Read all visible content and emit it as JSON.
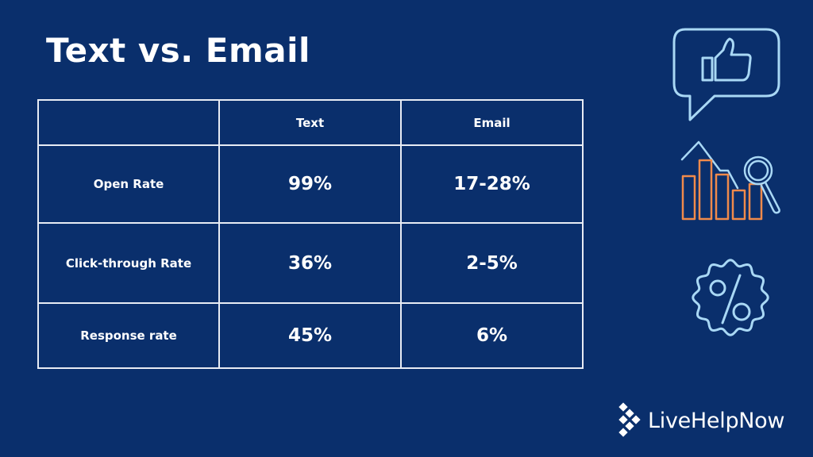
{
  "title": "Text vs. Email",
  "table": {
    "headers": [
      "",
      "Text",
      "Email"
    ],
    "rows": [
      {
        "label": "Open Rate",
        "text": "99%",
        "email": "17-28%"
      },
      {
        "label": "Click-through Rate",
        "text": "36%",
        "email": "2-5%"
      },
      {
        "label": "Response rate",
        "text": "45%",
        "email": "6%"
      }
    ]
  },
  "icons": [
    "thumbs-up-speech-bubble-icon",
    "bar-chart-magnifier-icon",
    "percent-badge-icon"
  ],
  "brand": {
    "name": "LiveHelpNow",
    "colors": {
      "background": "#0a2f6c",
      "icon_light_blue": "#a9d8f5",
      "icon_orange": "#f08a4b",
      "table_border": "#e8ecf4"
    }
  }
}
